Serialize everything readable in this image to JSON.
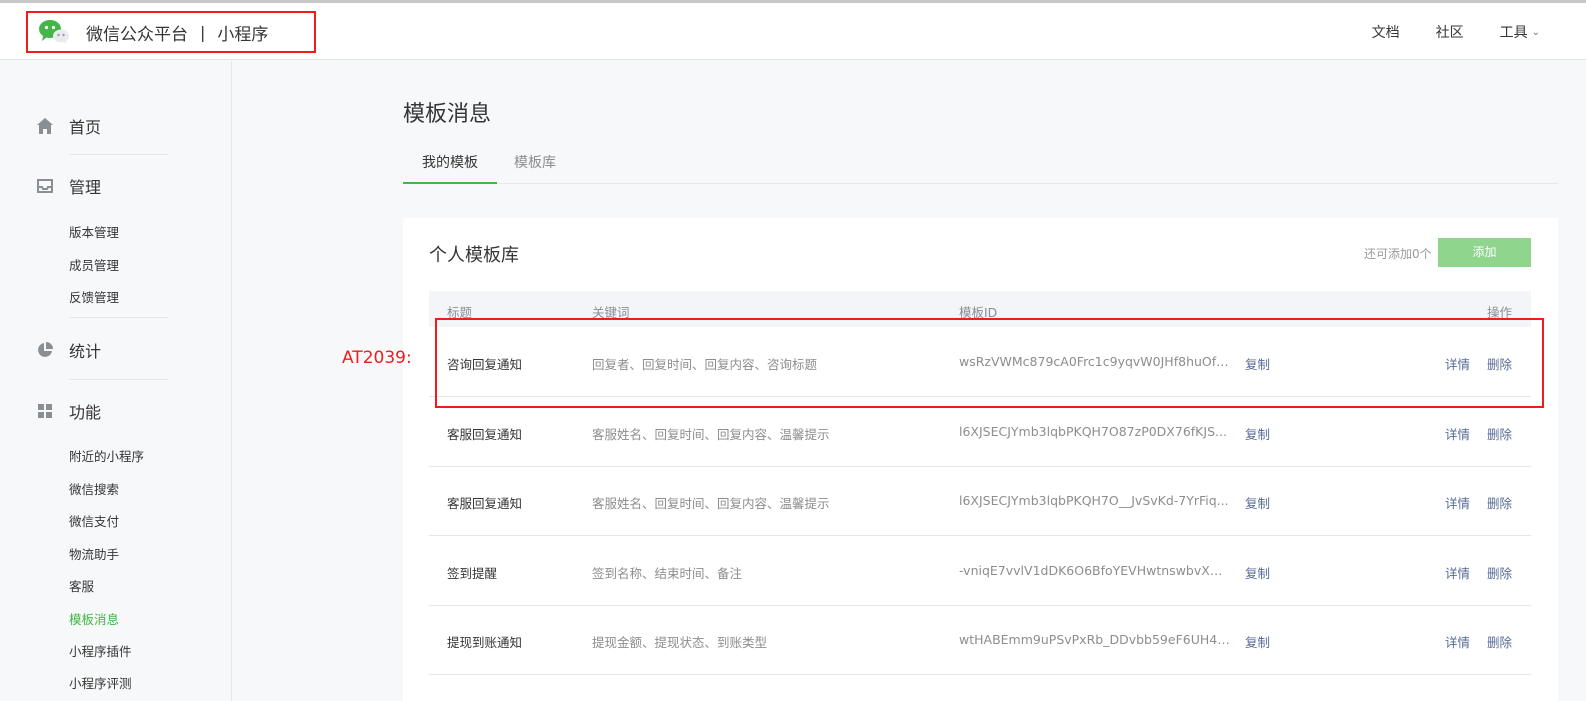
{
  "header": {
    "brand_name": "微信公众平台",
    "separator": "|",
    "product": "小程序",
    "nav": [
      {
        "label": "文档"
      },
      {
        "label": "社区"
      },
      {
        "label": "工具"
      }
    ]
  },
  "sidebar": {
    "groups": [
      {
        "label": "首页",
        "icon": "home-icon"
      },
      {
        "label": "管理",
        "icon": "inbox-icon",
        "items": [
          "版本管理",
          "成员管理",
          "反馈管理"
        ]
      },
      {
        "label": "统计",
        "icon": "pie-chart-icon"
      },
      {
        "label": "功能",
        "icon": "grid-icon",
        "items": [
          "附近的小程序",
          "微信搜索",
          "微信支付",
          "物流助手",
          "客服",
          "模板消息",
          "小程序插件",
          "小程序评测"
        ]
      }
    ],
    "active_item": "模板消息"
  },
  "main": {
    "title": "模板消息",
    "tabs": [
      {
        "label": "我的模板",
        "active": true
      },
      {
        "label": "模板库",
        "active": false
      }
    ],
    "card": {
      "title": "个人模板库",
      "quota_text": "还可添加0个",
      "add_button": "添加",
      "columns": [
        "标题",
        "关键词",
        "模板ID",
        "操作"
      ],
      "rows": [
        {
          "title": "咨询回复通知",
          "keywords": "回复者、回复时间、回复内容、咨询标题",
          "template_id": "wsRzVWMc879cA0Frc1c9yqvW0JHf8huOfJ...",
          "copy": "复制",
          "detail": "详情",
          "delete": "删除"
        },
        {
          "title": "客服回复通知",
          "keywords": "客服姓名、回复时间、回复内容、温馨提示",
          "template_id": "l6XJSECJYmb3lqbPKQH7O87zP0DX76fKJS...",
          "copy": "复制",
          "detail": "详情",
          "delete": "删除"
        },
        {
          "title": "客服回复通知",
          "keywords": "客服姓名、回复时间、回复内容、温馨提示",
          "template_id": "l6XJSECJYmb3lqbPKQH7O__JvSvKd-7YrFiq...",
          "copy": "复制",
          "detail": "详情",
          "delete": "删除"
        },
        {
          "title": "签到提醒",
          "keywords": "签到名称、结束时间、备注",
          "template_id": "-vniqE7vvlV1dDK6O6BfoYEVHwtnswbvXGv...",
          "copy": "复制",
          "detail": "详情",
          "delete": "删除"
        },
        {
          "title": "提现到账通知",
          "keywords": "提现金额、提现状态、到账类型",
          "template_id": "wtHABEmm9uPSvPxRb_DDvbb59eF6UH4T...",
          "copy": "复制",
          "detail": "详情",
          "delete": "删除"
        }
      ]
    }
  },
  "annotation": {
    "label": "AT2039:",
    "color": "#f01c1c"
  },
  "colors": {
    "accent_green": "#44b549",
    "link_blue": "#576b95",
    "annotation_red": "#f01c1c"
  }
}
